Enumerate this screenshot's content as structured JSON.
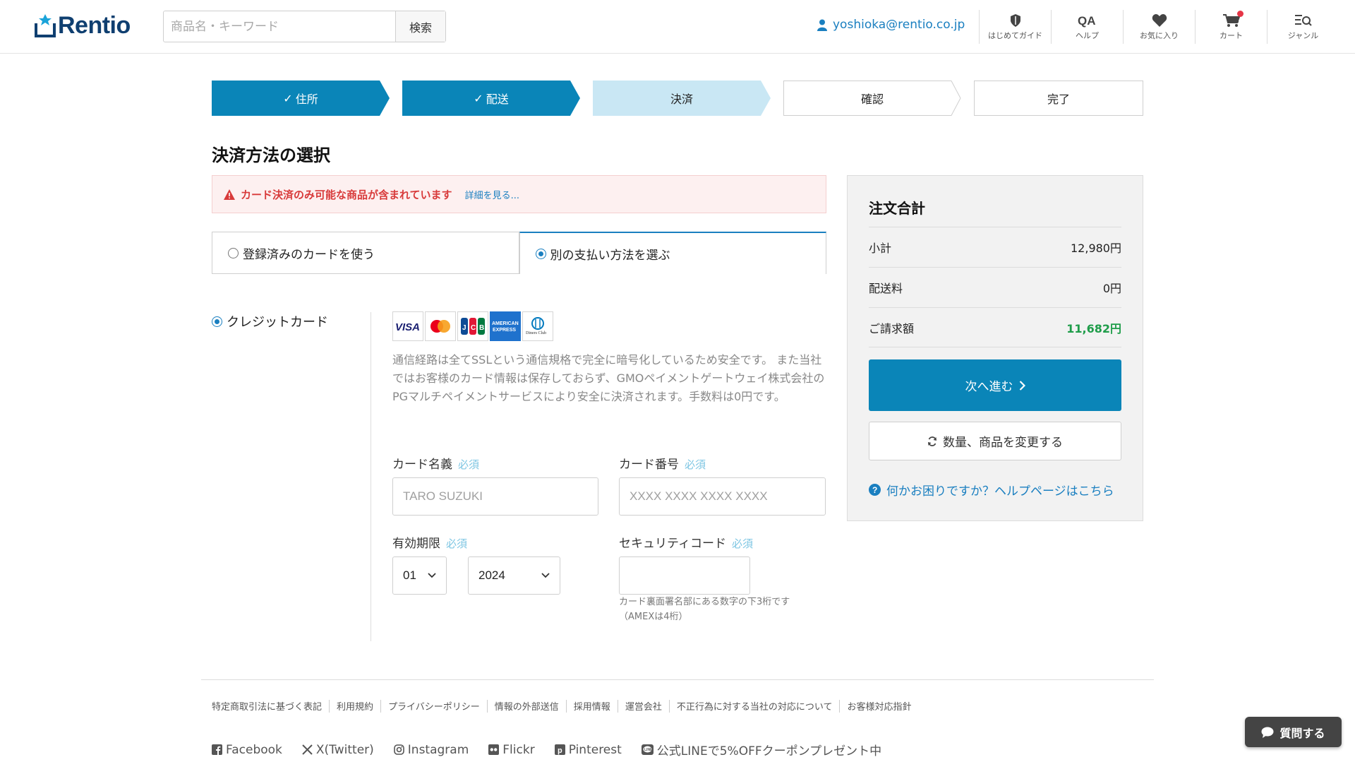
{
  "header": {
    "logo_text": "Rentio",
    "search_placeholder": "商品名・キーワード",
    "search_button": "検索",
    "user_email": "yoshioka@rentio.co.jp",
    "nav": [
      {
        "label": "はじめてガイド",
        "icon": "shield-icon"
      },
      {
        "label": "ヘルプ",
        "icon": "qa-icon"
      },
      {
        "label": "お気に入り",
        "icon": "heart-icon"
      },
      {
        "label": "カート",
        "icon": "cart-icon"
      },
      {
        "label": "ジャンル",
        "icon": "genre-search-icon"
      }
    ]
  },
  "steps": [
    {
      "label": "住所",
      "state": "done"
    },
    {
      "label": "配送",
      "state": "done"
    },
    {
      "label": "決済",
      "state": "current"
    },
    {
      "label": "確認",
      "state": "todo"
    },
    {
      "label": "完了",
      "state": "todo"
    }
  ],
  "main": {
    "title": "決済方法の選択",
    "alert_text": "カード決済のみ可能な商品が含まれています",
    "alert_link": "詳細を見る...",
    "tabs": [
      {
        "label": "登録済みのカードを使う",
        "selected": false
      },
      {
        "label": "別の支払い方法を選ぶ",
        "selected": true
      }
    ],
    "method_label": "クレジットカード",
    "card_brands": [
      "VISA",
      "Mastercard",
      "JCB",
      "AMERICAN EXPRESS",
      "Diners Club"
    ],
    "description": "通信経路は全てSSLという通信規格で完全に暗号化しているため安全です。 また当社ではお客様のカード情報は保存しておらず、GMOペイメントゲートウェイ株式会社のPGマルチペイメントサービスにより安全に決済されます。手数料は0円です。",
    "required": "必須",
    "card_name_label": "カード名義",
    "card_name_placeholder": "TARO SUZUKI",
    "card_number_label": "カード番号",
    "card_number_placeholder": "XXXX XXXX XXXX XXXX",
    "expiry_label": "有効期限",
    "expiry_month": "01",
    "expiry_year": "2024",
    "cvc_label": "セキュリティコード",
    "cvc_hint_line1": "カード裏面署名部にある数字の下3桁です",
    "cvc_hint_line2": "（AMEXは4桁）"
  },
  "summary": {
    "title": "注文合計",
    "rows": [
      {
        "label": "小計",
        "value": "12,980円"
      },
      {
        "label": "配送料",
        "value": "0円"
      },
      {
        "label": "ご請求額",
        "value": "11,682円"
      }
    ],
    "next_button": "次へ進む",
    "change_button": "数量、商品を変更する",
    "help_link": "何かお困りですか？ヘルプページはこちら"
  },
  "footer": {
    "links": [
      "特定商取引法に基づく表記",
      "利用規約",
      "プライバシーポリシー",
      "情報の外部送信",
      "採用情報",
      "運営会社",
      "不正行為に対する当社の対応について",
      "お客様対応指針"
    ],
    "social": [
      {
        "label": "Facebook",
        "icon": "facebook-icon"
      },
      {
        "label": "X(Twitter)",
        "icon": "x-icon"
      },
      {
        "label": "Instagram",
        "icon": "instagram-icon"
      },
      {
        "label": "Flickr",
        "icon": "flickr-icon"
      },
      {
        "label": "Pinterest",
        "icon": "pinterest-icon"
      },
      {
        "label": "公式LINEで5%OFFクーポンプレゼント中",
        "icon": "line-icon"
      }
    ],
    "chat_button": "質問する"
  },
  "colors": {
    "brand": "#0f3f70",
    "accent": "#0a85b8",
    "step_done": "#0a85b8",
    "step_current": "#c9e7f4",
    "alert": "#d83a3a",
    "total": "#1f9d4a"
  }
}
